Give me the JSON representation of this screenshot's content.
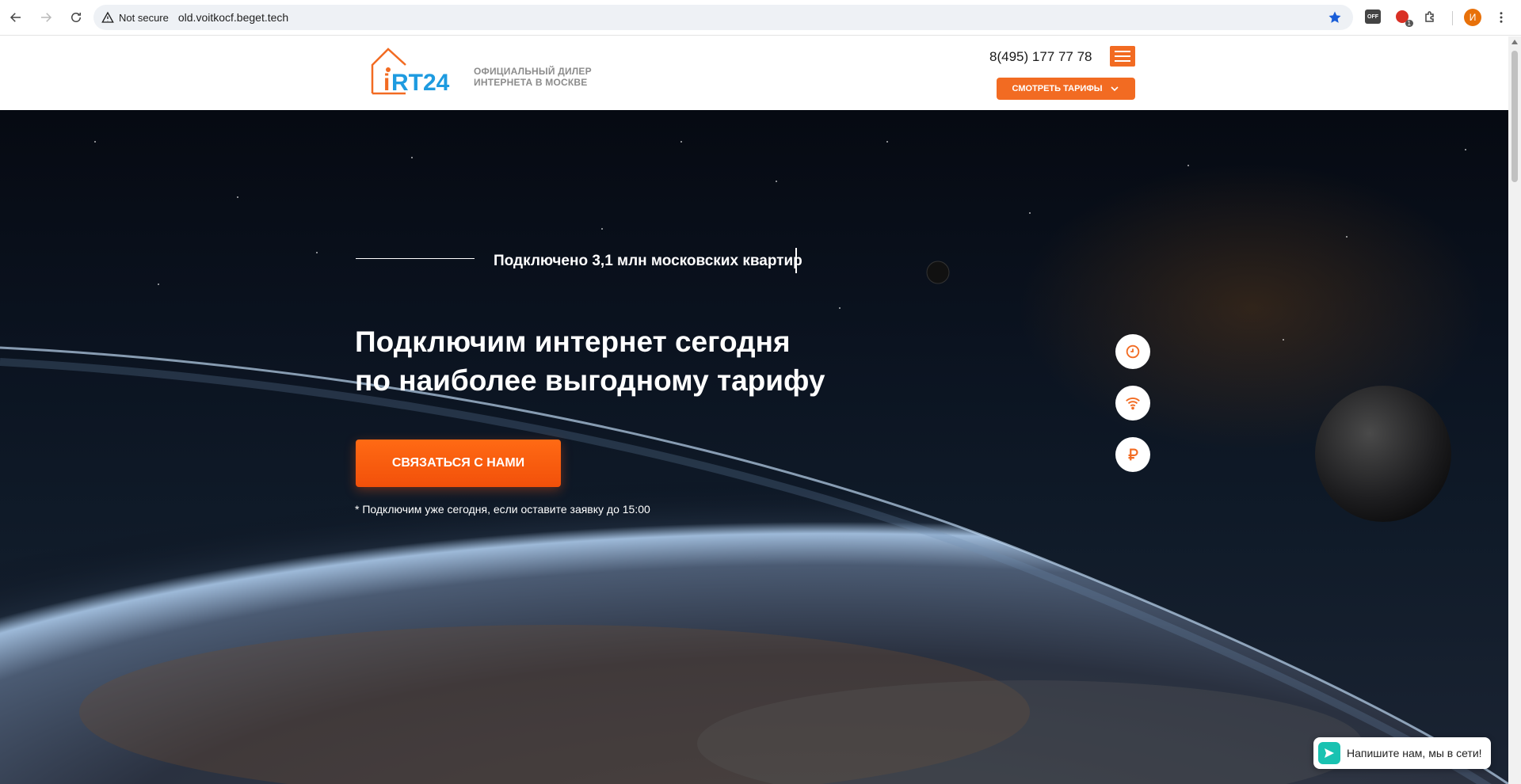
{
  "browser": {
    "security_label": "Not secure",
    "url": "old.voitkocf.beget.tech",
    "ext_off_label": "OFF",
    "ext_badge_count": "1",
    "profile_initial": "И"
  },
  "header": {
    "logo_text": "iRT24",
    "tagline_line1": "ОФИЦИАЛЬНЫЙ ДИЛЕР",
    "tagline_line2": "ИНТЕРНЕТА В МОСКВЕ",
    "phone": "8(495) 177 77 78",
    "tariffs_button": "СМОТРЕТЬ ТАРИФЫ"
  },
  "hero": {
    "counter_text": "Подключено 3,1 млн московских квартир",
    "headline_line1": "Подключим интернет сегодня",
    "headline_line2": "по наиболее выгодному тарифу",
    "cta_button": "СВЯЗАТЬСЯ С НАМИ",
    "note": "* Подключим уже сегодня, если оставите заявку до 15:00",
    "side_icons": [
      "clock-icon",
      "wifi-icon",
      "ruble-icon"
    ]
  },
  "chat": {
    "label": "Напишите нам, мы в сети!"
  },
  "colors": {
    "accent": "#f26b22",
    "logo_blue": "#1e9be0",
    "chat": "#19c2b1"
  }
}
